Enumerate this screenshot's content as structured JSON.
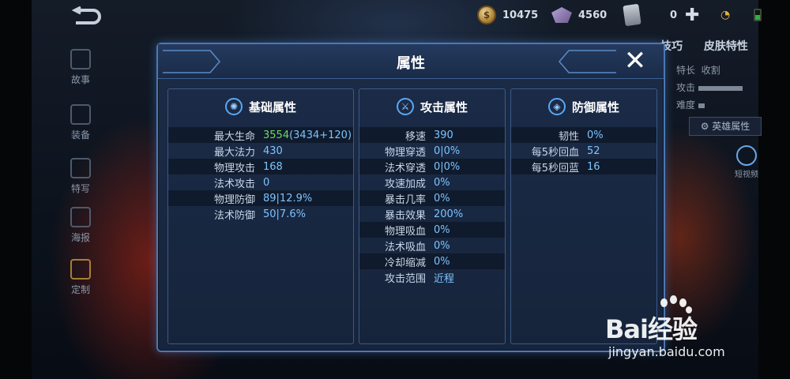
{
  "top_resources": {
    "gold": "10475",
    "gems": "4560",
    "tickets": "0"
  },
  "left_nav": [
    {
      "label": "故事"
    },
    {
      "label": "装备"
    },
    {
      "label": "特写"
    },
    {
      "label": "海报"
    },
    {
      "label": "定制"
    }
  ],
  "right_side": {
    "tabs": [
      "技巧",
      "皮肤特性"
    ],
    "info": [
      {
        "label": "特长",
        "value": "收割"
      },
      {
        "label": "攻击",
        "value": ""
      },
      {
        "label": "难度",
        "value": ""
      }
    ],
    "hero_attr_button": "英雄属性",
    "video_button": "短视频"
  },
  "dialog": {
    "title": "属性",
    "close": "✕",
    "panels": [
      {
        "title": "基础属性",
        "icon": "gear-icon",
        "rows": [
          {
            "label": "最大生命",
            "value": "3554",
            "extra": "(3434+120)"
          },
          {
            "label": "最大法力",
            "value": "430"
          },
          {
            "label": "物理攻击",
            "value": "168"
          },
          {
            "label": "法术攻击",
            "value": "0"
          },
          {
            "label": "物理防御",
            "value": "89|12.9%"
          },
          {
            "label": "法术防御",
            "value": "50|7.6%"
          }
        ]
      },
      {
        "title": "攻击属性",
        "icon": "sword-icon",
        "rows": [
          {
            "label": "移速",
            "value": "390"
          },
          {
            "label": "物理穿透",
            "value": "0|0%"
          },
          {
            "label": "法术穿透",
            "value": "0|0%"
          },
          {
            "label": "攻速加成",
            "value": "0%"
          },
          {
            "label": "暴击几率",
            "value": "0%"
          },
          {
            "label": "暴击效果",
            "value": "200%"
          },
          {
            "label": "物理吸血",
            "value": "0%"
          },
          {
            "label": "法术吸血",
            "value": "0%"
          },
          {
            "label": "冷却缩减",
            "value": "0%"
          },
          {
            "label": "攻击范围",
            "value": "近程"
          }
        ]
      },
      {
        "title": "防御属性",
        "icon": "shield-icon",
        "rows": [
          {
            "label": "韧性",
            "value": "0%"
          },
          {
            "label": "每5秒回血",
            "value": "52"
          },
          {
            "label": "每5秒回蓝",
            "value": "16"
          }
        ]
      }
    ]
  },
  "watermark": {
    "brand": "Bai经验",
    "url": "jingyan.baidu.com"
  }
}
